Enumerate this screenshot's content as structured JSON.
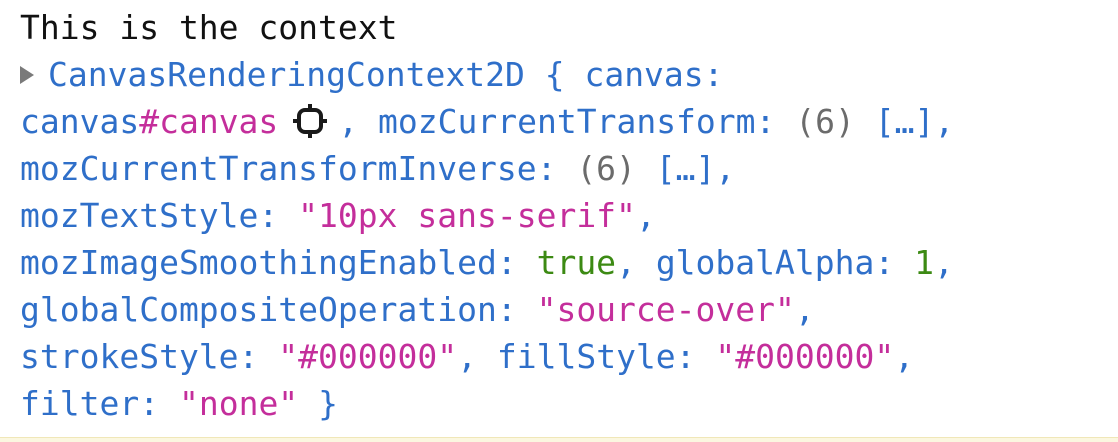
{
  "log_message": "This is the context",
  "object": {
    "class_name": "CanvasRenderingContext2D",
    "open_brace": "{",
    "close_brace": "}",
    "canvas_key": "canvas",
    "canvas_ref": {
      "tag": "canvas",
      "id": "#canvas"
    },
    "props": {
      "mozCurrentTransform": {
        "key": "mozCurrentTransform",
        "count": "(6)",
        "preview": "[…]"
      },
      "mozCurrentTransformInverse": {
        "key": "mozCurrentTransformInverse",
        "count": "(6)",
        "preview": "[…]"
      },
      "mozTextStyle": {
        "key": "mozTextStyle",
        "value": "\"10px sans-serif\""
      },
      "mozImageSmoothingEnabled": {
        "key": "mozImageSmoothingEnabled",
        "value": "true"
      },
      "globalAlpha": {
        "key": "globalAlpha",
        "value": "1"
      },
      "globalCompositeOperation": {
        "key": "globalCompositeOperation",
        "value": "\"source-over\""
      },
      "strokeStyle": {
        "key": "strokeStyle",
        "value": "\"#000000\""
      },
      "fillStyle": {
        "key": "fillStyle",
        "value": "\"#000000\""
      },
      "filter": {
        "key": "filter",
        "value": "\"none\""
      }
    }
  },
  "icons": {
    "expand": "expand-triangle-icon",
    "inspect": "inspect-node-target-icon"
  },
  "colors": {
    "key": "#2f6fc9",
    "string": "#c42e9b",
    "boolean": "#3c8a13",
    "number": "#3c8a13",
    "muted": "#6b6b6b",
    "text": "#111111"
  }
}
